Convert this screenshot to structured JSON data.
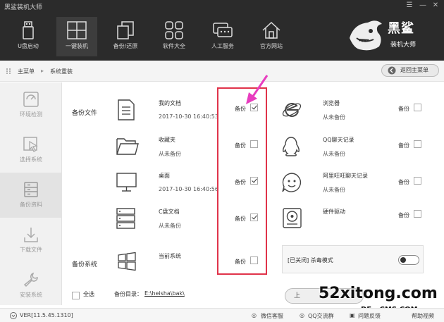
{
  "app": {
    "title": "黑鲨装机大师",
    "brand_line1": "黑鲨",
    "brand_line2": "装机大师",
    "window_controls": [
      "☰",
      "—",
      "✕"
    ]
  },
  "top_nav": [
    {
      "label": "U盘启动",
      "icon": "usb-drive-icon",
      "active": false
    },
    {
      "label": "一键装机",
      "icon": "windows-icon",
      "active": true
    },
    {
      "label": "备份/还原",
      "icon": "backup-restore-icon",
      "active": false
    },
    {
      "label": "软件大全",
      "icon": "apps-grid-icon",
      "active": false
    },
    {
      "label": "人工服务",
      "icon": "chat-icon",
      "active": false
    },
    {
      "label": "官方网站",
      "icon": "home-icon",
      "active": false
    }
  ],
  "breadcrumb": {
    "root": "主菜单",
    "current": "系统重装"
  },
  "back_button": {
    "label": "返回主菜单"
  },
  "sidebar": [
    {
      "label": "环境检测",
      "icon": "environment-check-icon",
      "active": false
    },
    {
      "label": "选择系统",
      "icon": "cursor-select-icon",
      "active": false
    },
    {
      "label": "备份资料",
      "icon": "backup-data-icon",
      "active": true
    },
    {
      "label": "下载文件",
      "icon": "download-icon",
      "active": false
    },
    {
      "label": "安装系统",
      "icon": "wrench-icon",
      "active": false
    }
  ],
  "sections": {
    "backup_files": "备份文件",
    "backup_system": "备份系统"
  },
  "backup_label": "备份",
  "left_items": [
    {
      "name": "我的文档",
      "sub": "2017-10-30 16:40:53",
      "checked": true,
      "icon": "document-icon"
    },
    {
      "name": "收藏夹",
      "sub": "从未备份",
      "checked": false,
      "icon": "folder-icon"
    },
    {
      "name": "桌面",
      "sub": "2017-10-30 16:40:56",
      "checked": true,
      "icon": "monitor-icon"
    },
    {
      "name": "C盘文档",
      "sub": "从未备份",
      "checked": true,
      "icon": "server-icon"
    },
    {
      "name": "当前系统",
      "sub": "",
      "checked": false,
      "icon": "windows-logo-icon"
    }
  ],
  "right_items": [
    {
      "name": "浏览器",
      "sub": "从未备份",
      "checked": false,
      "icon": "ie-browser-icon"
    },
    {
      "name": "QQ聊天记录",
      "sub": "从未备份",
      "checked": false,
      "icon": "qq-penguin-icon"
    },
    {
      "name": "阿里旺旺聊天记录",
      "sub": "从未备份",
      "checked": false,
      "icon": "aliwangwang-icon"
    },
    {
      "name": "硬件驱动",
      "sub": "",
      "checked": false,
      "icon": "hardware-driver-icon"
    }
  ],
  "antivirus": {
    "label": "[已关闭] 杀毒模式",
    "enabled": false
  },
  "bottom": {
    "select_all": "全选",
    "dir_label": "备份目录：",
    "dir_path": "E:\\heisha\\bak\\",
    "action_partial": "上"
  },
  "watermark": {
    "main": "52xitong.com",
    "sub": "DE...CMS.COM"
  },
  "status": {
    "version": "VER[11.5.45.1310]",
    "links": [
      "微信客服",
      "QQ交流群",
      "问题反馈",
      "帮助视频"
    ]
  },
  "colors": {
    "highlight_box": "#e0334a",
    "arrow": "#e83dbf",
    "topbar": "#2b2b2b"
  }
}
